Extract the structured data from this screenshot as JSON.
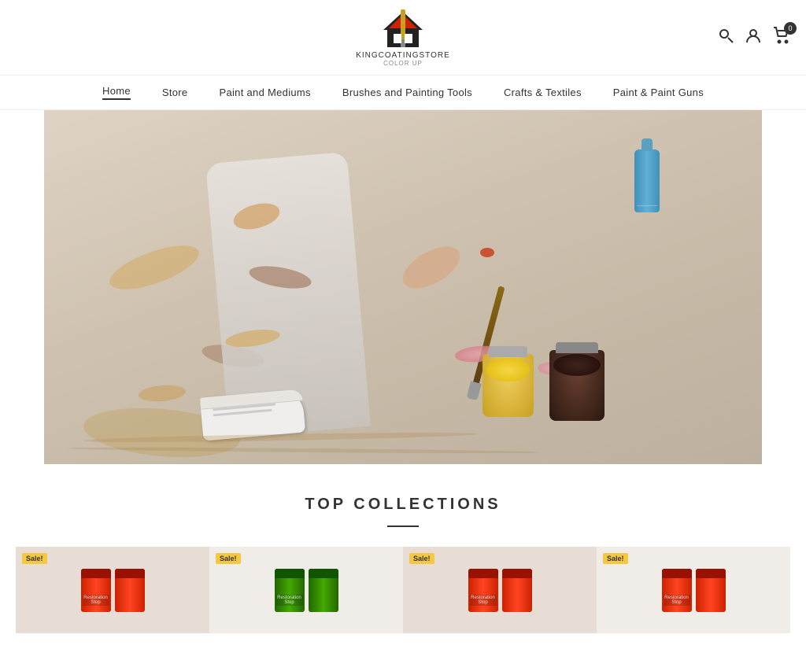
{
  "header": {
    "logo_text": "KINGCOATINGSTORE",
    "logo_subtext": "COLOR UP"
  },
  "nav": {
    "items": [
      {
        "label": "Home",
        "active": true
      },
      {
        "label": "Store",
        "active": false
      },
      {
        "label": "Paint and Mediums",
        "active": false
      },
      {
        "label": "Brushes and Painting Tools",
        "active": false
      },
      {
        "label": "Crafts & Textiles",
        "active": false
      },
      {
        "label": "Paint & Paint Guns",
        "active": false
      }
    ]
  },
  "cart": {
    "count": "0"
  },
  "collections": {
    "title": "TOP COLLECTIONS"
  },
  "products": [
    {
      "sale": "Sale!",
      "bg": "bg-warm",
      "color1": "can-red",
      "color2": "can-red"
    },
    {
      "sale": "Sale!",
      "bg": "bg-light",
      "color1": "can-green",
      "color2": "can-green"
    },
    {
      "sale": "Sale!",
      "bg": "bg-warm",
      "color1": "can-red",
      "color2": "can-red"
    },
    {
      "sale": "Sale!",
      "bg": "bg-light",
      "color1": "can-red",
      "color2": "can-red"
    }
  ]
}
